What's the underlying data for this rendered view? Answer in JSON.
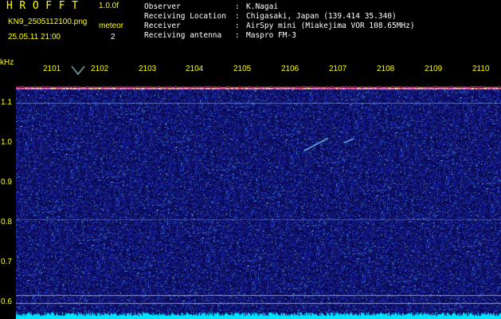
{
  "header": {
    "app_title": "HROFFT",
    "version": "1.0.0f",
    "filename": "KN9_2505112100.png",
    "datetime": "25.05.11 21:00",
    "mode_label": "meteor",
    "mode_value": "2",
    "info": [
      {
        "key": "Observer",
        "value": "K.Nagai"
      },
      {
        "key": "Receiving Location",
        "value": "Chigasaki, Japan (139.414 35.340)"
      },
      {
        "key": "Receiver",
        "value": "AirSpy mini (Miakejima VOR 108.65MHz)"
      },
      {
        "key": "Receiving antenna",
        "value": "Maspro FM-3"
      }
    ]
  },
  "plot": {
    "y_unit": "kHz",
    "y_ticks": [
      "1.1",
      "1.0",
      "0.9",
      "0.8",
      "0.7",
      "0.6"
    ],
    "x_ticks": [
      "2101",
      "2102",
      "2103",
      "2104",
      "2105",
      "2106",
      "2107",
      "2108",
      "2109",
      "2110"
    ],
    "colors": {
      "background": "#000000",
      "label": "#ffff00",
      "noise_base": "#1a1a6e",
      "carrier": "#ff66cc",
      "floor": "#00e5ff"
    }
  }
}
